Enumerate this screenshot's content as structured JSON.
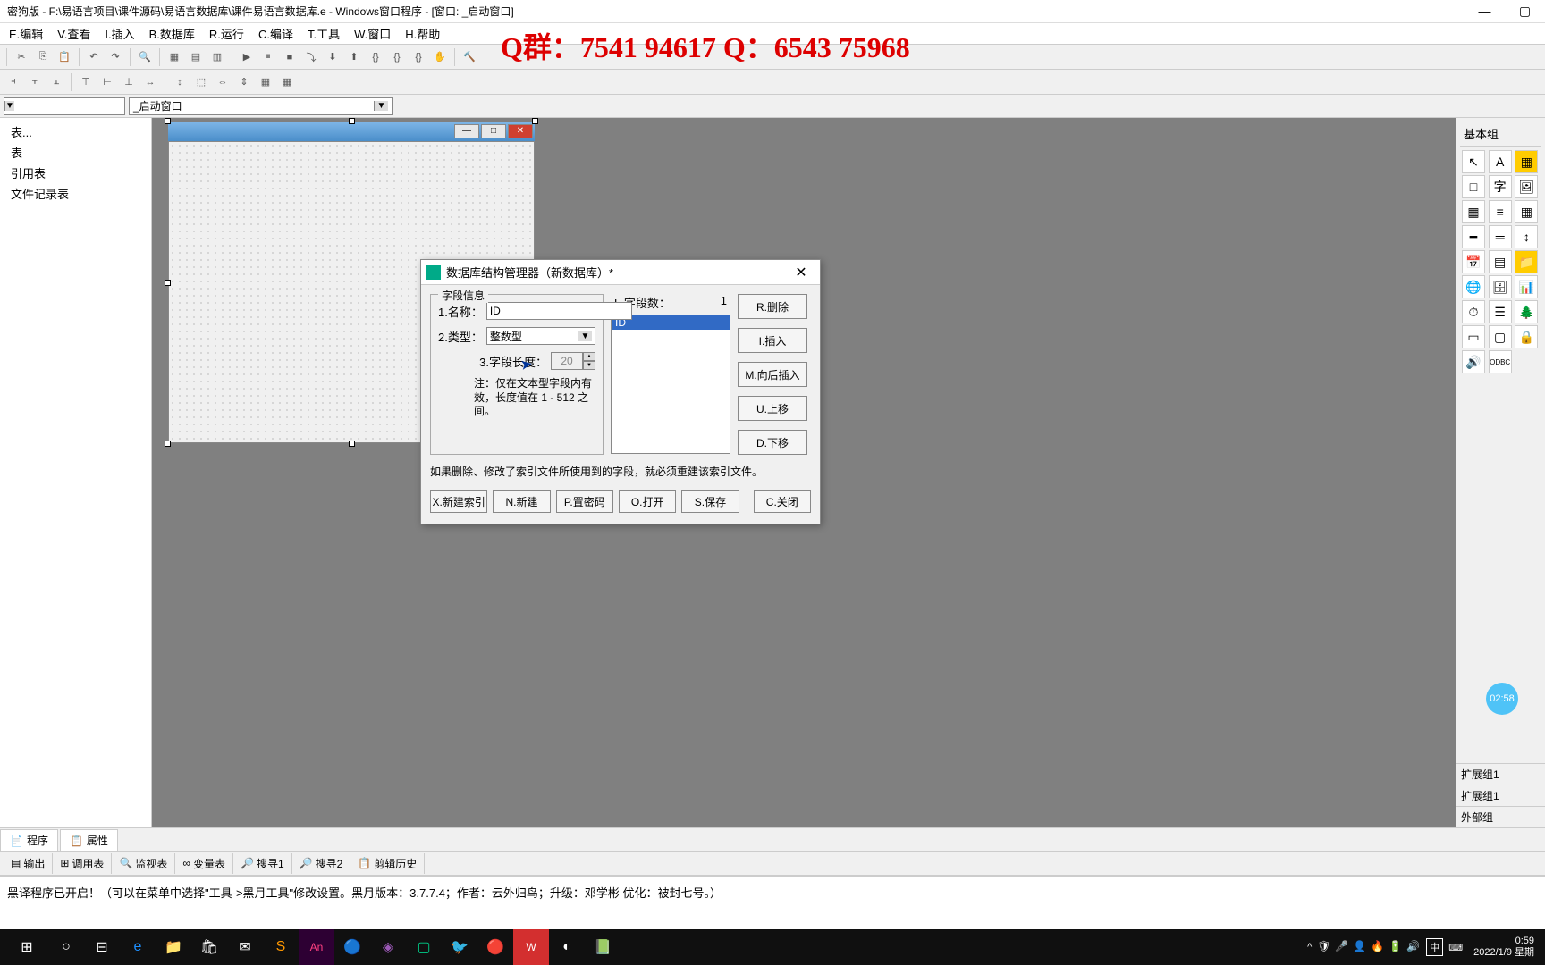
{
  "window": {
    "title": "密狗版 - F:\\易语言项目\\课件源码\\易语言数据库\\课件易语言数据库.e - Windows窗口程序 - [窗口: _启动窗口]"
  },
  "menu": {
    "edit": "E.编辑",
    "view": "V.查看",
    "insert": "I.插入",
    "database": "B.数据库",
    "run": "R.运行",
    "compile": "C.编译",
    "tools": "T.工具",
    "window": "W.窗口",
    "help": "H.帮助"
  },
  "overlay": "Q群：7541 94617 Q：6543 75968",
  "combo": {
    "window_selector": "_启动窗口"
  },
  "tree": {
    "item1": "表...",
    "item2": "表",
    "item3": "引用表",
    "item4": "文件记录表"
  },
  "right_panel": {
    "header": "基本组",
    "ext1": "扩展组1",
    "ext2": "扩展组1",
    "external": "外部组"
  },
  "bottom_tabs": {
    "program": "程序",
    "property": "属性"
  },
  "debug_tabs": {
    "output": "输出",
    "calltable": "调用表",
    "watch": "监视表",
    "vartable": "变量表",
    "search1": "搜寻1",
    "search2": "搜寻2",
    "clipboard": "剪辑历史"
  },
  "status": "黑译程序已开启！（可以在菜单中选择\"工具->黑月工具\"修改设置。黑月版本：3.7.7.4；作者：云外归鸟；升级：邓学彬 优化：被封七号。）",
  "dialog": {
    "title": "数据库结构管理器（新数据库）*",
    "fieldset_title": "字段信息",
    "name_label": "1.名称：",
    "name_value": "ID",
    "type_label": "2.类型：",
    "type_value": "整数型",
    "length_label": "3.字段长度：",
    "length_value": "20",
    "length_note": "注：仅在文本型字段内有效，长度值在 1 - 512 之间。",
    "fieldcount_label": "L.字段数：",
    "fieldcount_value": "1",
    "list_item1": "ID",
    "btn_delete": "R.删除",
    "btn_insert": "I.插入",
    "btn_insert_after": "M.向后插入",
    "btn_up": "U.上移",
    "btn_down": "D.下移",
    "index_note": "如果删除、修改了索引文件所使用到的字段，就必须重建该索引文件。",
    "btn_new_index": "X.新建索引",
    "btn_new": "N.新建",
    "btn_password": "P.置密码",
    "btn_open": "O.打开",
    "btn_save": "S.保存",
    "btn_close": "C.关闭"
  },
  "taskbar": {
    "time": "0:59",
    "date": "2022/1/9 星期",
    "ime": "中",
    "badge": "02:58"
  }
}
